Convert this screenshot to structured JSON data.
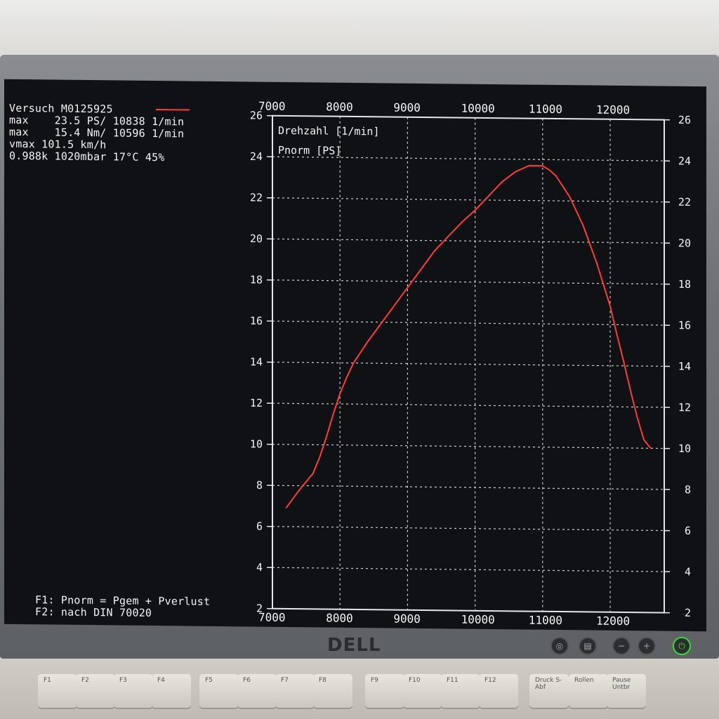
{
  "info": {
    "line1": "Versuch M0125925",
    "line2": "max    23.5 PS/ 10838 1/min",
    "line3": "max    15.4 Nm/ 10596 1/min",
    "line4": "vmax 101.5 km/h",
    "line5": "0.988k 1020mbar 17°C 45%"
  },
  "footer": {
    "f1": "F1: Pnorm = Pgem + Pverlust",
    "f2": "F2: nach DIN 70020"
  },
  "brand": "DELL",
  "keys": [
    "F1",
    "F2",
    "F3",
    "F4",
    "F5",
    "F6",
    "F7",
    "F8",
    "F9",
    "F10",
    "F11",
    "F12",
    "Druck S-Abf",
    "Rollen",
    "Pause Untbr"
  ],
  "chart_data": {
    "type": "line",
    "labels": [
      "Drehzahl [1/min]",
      "Pnorm [PS]"
    ],
    "xlim": [
      7000,
      12800
    ],
    "ylim": [
      2,
      26
    ],
    "x_ticks": [
      7000,
      8000,
      9000,
      10000,
      11000,
      12000
    ],
    "y_ticks": [
      2,
      4,
      6,
      8,
      10,
      12,
      14,
      16,
      18,
      20,
      22,
      24,
      26
    ],
    "grid": true,
    "series": [
      {
        "color": "#ff3b3b",
        "x": [
          7200,
          7400,
          7600,
          7700,
          7800,
          7900,
          8000,
          8100,
          8200,
          8300,
          8400,
          8600,
          8800,
          9000,
          9200,
          9400,
          9600,
          9800,
          10000,
          10200,
          10400,
          10600,
          10800,
          11000,
          11100,
          11200,
          11400,
          11600,
          11800,
          12000,
          12100,
          12200,
          12300,
          12400,
          12500,
          12600
        ],
        "y": [
          6.9,
          7.8,
          8.6,
          9.4,
          10.4,
          11.5,
          12.5,
          13.3,
          14.0,
          14.5,
          15.0,
          15.9,
          16.8,
          17.7,
          18.6,
          19.5,
          20.2,
          20.9,
          21.5,
          22.2,
          22.9,
          23.4,
          23.7,
          23.7,
          23.5,
          23.2,
          22.2,
          20.8,
          19.0,
          16.9,
          15.5,
          14.2,
          12.8,
          11.5,
          10.4,
          10.0
        ]
      }
    ]
  }
}
